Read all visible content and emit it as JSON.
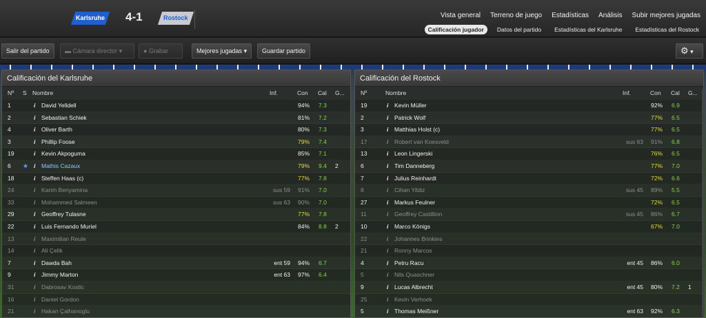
{
  "match": {
    "home_team": "Karlsruhe",
    "away_team": "Rostock",
    "score": "4-1"
  },
  "nav": {
    "main": [
      "Vista general",
      "Terreno de juego",
      "Estadísticas",
      "Análisis",
      "Subir mejores jugadas"
    ],
    "sub": [
      "Calificación jugador",
      "Datos del partido",
      "Estadísticas del Karlsruhe",
      "Estadísticas del Rostock"
    ],
    "active_sub": "Calificación jugador"
  },
  "toolbar": {
    "exit_label": "Salir del partido",
    "camera_label": "Cámara director",
    "record_label": "Grabar",
    "best_plays_label": "Mejores jugadas",
    "save_label": "Guardar partido"
  },
  "columns": {
    "no": "Nº",
    "s": "S",
    "name": "Nombre",
    "inf": "Inf.",
    "con": "Con",
    "cal": "Cal",
    "g": "G..."
  },
  "home": {
    "title": "Calificación del Karlsruhe",
    "players": [
      {
        "no": "1",
        "name": "David Yelldell",
        "inf": "",
        "con": "94%",
        "cal": "7.3",
        "g": "",
        "sub": false
      },
      {
        "no": "2",
        "name": "Sebastian Schiek",
        "inf": "",
        "con": "81%",
        "cal": "7.2",
        "g": "",
        "sub": false
      },
      {
        "no": "4",
        "name": "Oliver Barth",
        "inf": "",
        "con": "80%",
        "cal": "7.3",
        "g": "",
        "sub": false
      },
      {
        "no": "3",
        "name": "Phillip Foose",
        "inf": "",
        "con": "79%",
        "cal": "7.4",
        "g": "",
        "sub": false
      },
      {
        "no": "19",
        "name": "Kevin Akpoguma",
        "inf": "",
        "con": "85%",
        "cal": "7.1",
        "g": "",
        "sub": false
      },
      {
        "no": "6",
        "name": "Mathis Cazaux",
        "inf": "",
        "con": "79%",
        "cal": "9.4",
        "g": "2",
        "sub": false,
        "star": true
      },
      {
        "no": "18",
        "name": "Steffen Haas (c)",
        "inf": "",
        "con": "77%",
        "cal": "7.8",
        "g": "",
        "sub": false
      },
      {
        "no": "24",
        "name": "Karim Benyamina",
        "inf": "sus 59",
        "con": "91%",
        "cal": "7.0",
        "g": "",
        "sub": true
      },
      {
        "no": "33",
        "name": "Mohammed Salmeen",
        "inf": "sus 63",
        "con": "90%",
        "cal": "7.0",
        "g": "",
        "sub": true
      },
      {
        "no": "29",
        "name": "Geoffrey Tulasne",
        "inf": "",
        "con": "77%",
        "cal": "7.8",
        "g": "",
        "sub": false
      },
      {
        "no": "22",
        "name": "Luis Fernando Muriel",
        "inf": "",
        "con": "84%",
        "cal": "8.8",
        "g": "2",
        "sub": false
      },
      {
        "no": "13",
        "name": "Maximilian Reule",
        "inf": "",
        "con": "",
        "cal": "",
        "g": "",
        "sub": true
      },
      {
        "no": "14",
        "name": "Ali Çelik",
        "inf": "",
        "con": "",
        "cal": "",
        "g": "",
        "sub": true
      },
      {
        "no": "7",
        "name": "Dawda Bah",
        "inf": "ent 59",
        "con": "94%",
        "cal": "6.7",
        "g": "",
        "sub": false
      },
      {
        "no": "9",
        "name": "Jimmy Marton",
        "inf": "ent 63",
        "con": "97%",
        "cal": "6.4",
        "g": "",
        "sub": false
      },
      {
        "no": "31",
        "name": "Dabrosav Kostic",
        "inf": "",
        "con": "",
        "cal": "",
        "g": "",
        "sub": true
      },
      {
        "no": "16",
        "name": "Daniel Gordon",
        "inf": "",
        "con": "",
        "cal": "",
        "g": "",
        "sub": true
      },
      {
        "no": "21",
        "name": "Hakan Çalhanoglu",
        "inf": "",
        "con": "",
        "cal": "",
        "g": "",
        "sub": true
      }
    ]
  },
  "away": {
    "title": "Calificación del Rostock",
    "players": [
      {
        "no": "19",
        "name": "Kevin Müller",
        "inf": "",
        "con": "92%",
        "cal": "6.9",
        "g": "",
        "sub": false
      },
      {
        "no": "2",
        "name": "Patrick Wolf",
        "inf": "",
        "con": "77%",
        "cal": "6.5",
        "g": "",
        "sub": false
      },
      {
        "no": "3",
        "name": "Matthias Holst (c)",
        "inf": "",
        "con": "77%",
        "cal": "6.5",
        "g": "",
        "sub": false
      },
      {
        "no": "17",
        "name": "Robert van Koesveld",
        "inf": "sus 63",
        "con": "91%",
        "cal": "6.8",
        "g": "",
        "sub": true
      },
      {
        "no": "13",
        "name": "Leon Lingerski",
        "inf": "",
        "con": "76%",
        "cal": "6.5",
        "g": "",
        "sub": false
      },
      {
        "no": "6",
        "name": "Tim Danneberg",
        "inf": "",
        "con": "77%",
        "cal": "7.0",
        "g": "",
        "sub": false
      },
      {
        "no": "7",
        "name": "Julius Reinhardt",
        "inf": "",
        "con": "72%",
        "cal": "6.6",
        "g": "",
        "sub": false
      },
      {
        "no": "8",
        "name": "Cihan Yildiz",
        "inf": "sus 45",
        "con": "89%",
        "cal": "5.5",
        "g": "",
        "sub": true
      },
      {
        "no": "27",
        "name": "Markus Feulner",
        "inf": "",
        "con": "72%",
        "cal": "6.5",
        "g": "",
        "sub": false
      },
      {
        "no": "11",
        "name": "Geoffrey Castillion",
        "inf": "sus 45",
        "con": "86%",
        "cal": "6.7",
        "g": "",
        "sub": true
      },
      {
        "no": "10",
        "name": "Marco Königs",
        "inf": "",
        "con": "67%",
        "cal": "7.0",
        "g": "",
        "sub": false
      },
      {
        "no": "22",
        "name": "Johannes Brinkies",
        "inf": "",
        "con": "",
        "cal": "",
        "g": "",
        "sub": true
      },
      {
        "no": "21",
        "name": "Ronny Marcos",
        "inf": "",
        "con": "",
        "cal": "",
        "g": "",
        "sub": true
      },
      {
        "no": "4",
        "name": "Petru Racu",
        "inf": "ent 45",
        "con": "86%",
        "cal": "6.0",
        "g": "",
        "sub": false
      },
      {
        "no": "5",
        "name": "Nils Quaschner",
        "inf": "",
        "con": "",
        "cal": "",
        "g": "",
        "sub": true
      },
      {
        "no": "9",
        "name": "Lucas Albrecht",
        "inf": "ent 45",
        "con": "80%",
        "cal": "7.2",
        "g": "1",
        "sub": false
      },
      {
        "no": "25",
        "name": "Kevin Verhoek",
        "inf": "",
        "con": "",
        "cal": "",
        "g": "",
        "sub": true
      },
      {
        "no": "5",
        "name": "Thomas Meißner",
        "inf": "ent 63",
        "con": "92%",
        "cal": "6.3",
        "g": "",
        "sub": false
      }
    ]
  },
  "icons": {
    "settings": "gear-icon",
    "camera": "camera-icon",
    "record": "record-icon",
    "info": "info-icon",
    "star": "star-icon"
  },
  "colors": {
    "home_badge": "#1f5fcf",
    "away_badge": "#c8cbd2",
    "rating": "#8ad04a",
    "condition": "#e6dc3c"
  }
}
